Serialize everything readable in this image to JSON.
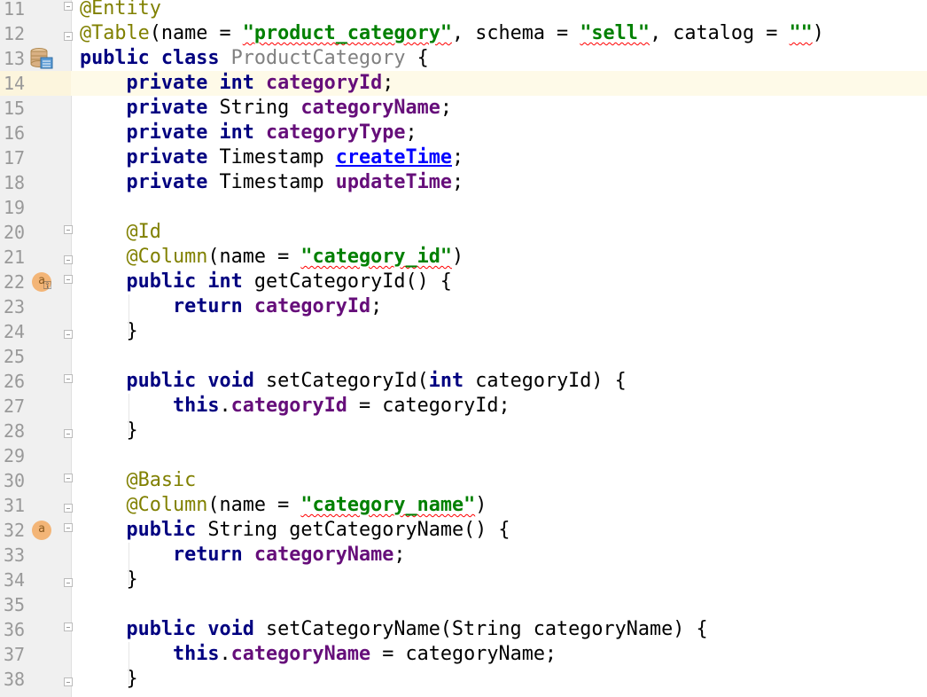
{
  "editor": {
    "current_line": 14,
    "lines": [
      {
        "n": "11",
        "fold": "open",
        "tokens": [
          [
            "@Entity",
            "ann"
          ]
        ]
      },
      {
        "n": "12",
        "fold": "close",
        "tokens": [
          [
            "@Table",
            "ann"
          ],
          [
            "(name = ",
            ""
          ],
          [
            "\"product_category\"",
            "str squig"
          ],
          [
            ", schema = ",
            ""
          ],
          [
            "\"sell\"",
            "str squig"
          ],
          [
            ", catalog = ",
            ""
          ],
          [
            "\"\"",
            "str squig"
          ],
          [
            ")",
            ""
          ]
        ]
      },
      {
        "n": "13",
        "icon": "database-table-icon",
        "tokens": [
          [
            "public class ",
            "kw"
          ],
          [
            "ProductCategory",
            "unused"
          ],
          [
            " {",
            ""
          ]
        ]
      },
      {
        "n": "14",
        "tokens": [
          [
            "    private int ",
            "kw"
          ],
          [
            "categoryId",
            "fld"
          ],
          [
            ";",
            ""
          ]
        ]
      },
      {
        "n": "15",
        "tokens": [
          [
            "    private ",
            "kw"
          ],
          [
            "String ",
            ""
          ],
          [
            "categoryName",
            "fld"
          ],
          [
            ";",
            ""
          ]
        ]
      },
      {
        "n": "16",
        "tokens": [
          [
            "    private int ",
            "kw"
          ],
          [
            "categoryType",
            "fld"
          ],
          [
            ";",
            ""
          ]
        ]
      },
      {
        "n": "17",
        "tokens": [
          [
            "    private ",
            "kw"
          ],
          [
            "Timestamp ",
            ""
          ],
          [
            "createTime",
            "link"
          ],
          [
            ";",
            ""
          ]
        ]
      },
      {
        "n": "18",
        "tokens": [
          [
            "    private ",
            "kw"
          ],
          [
            "Timestamp ",
            ""
          ],
          [
            "updateTime",
            "fld"
          ],
          [
            ";",
            ""
          ]
        ]
      },
      {
        "n": "19",
        "tokens": []
      },
      {
        "n": "20",
        "fold": "open",
        "tokens": [
          [
            "    @Id",
            "ann"
          ]
        ]
      },
      {
        "n": "21",
        "fold": "close",
        "tokens": [
          [
            "    @Column",
            "ann"
          ],
          [
            "(name = ",
            ""
          ],
          [
            "\"category_id\"",
            "str squig"
          ],
          [
            ")",
            ""
          ]
        ]
      },
      {
        "n": "22",
        "fold": "open",
        "icon": "attribute-key-icon",
        "icon_text": "a",
        "tokens": [
          [
            "    public int ",
            "kw"
          ],
          [
            "getCategoryId() {",
            ""
          ]
        ]
      },
      {
        "n": "23",
        "tokens": [
          [
            "        return ",
            "kw"
          ],
          [
            "categoryId",
            "fld"
          ],
          [
            ";",
            ""
          ]
        ]
      },
      {
        "n": "24",
        "fold": "close",
        "tokens": [
          [
            "    }",
            ""
          ]
        ]
      },
      {
        "n": "25",
        "tokens": []
      },
      {
        "n": "26",
        "fold": "open",
        "tokens": [
          [
            "    public void ",
            "kw"
          ],
          [
            "setCategoryId(",
            ""
          ],
          [
            "int ",
            "kw"
          ],
          [
            "categoryId) {",
            ""
          ]
        ]
      },
      {
        "n": "27",
        "tokens": [
          [
            "        this",
            "kw"
          ],
          [
            ".",
            ""
          ],
          [
            "categoryId",
            "fld"
          ],
          [
            " = categoryId;",
            ""
          ]
        ]
      },
      {
        "n": "28",
        "fold": "close",
        "tokens": [
          [
            "    }",
            ""
          ]
        ]
      },
      {
        "n": "29",
        "tokens": []
      },
      {
        "n": "30",
        "fold": "open",
        "tokens": [
          [
            "    @Basic",
            "ann"
          ]
        ]
      },
      {
        "n": "31",
        "fold": "close",
        "tokens": [
          [
            "    @Column",
            "ann"
          ],
          [
            "(name = ",
            ""
          ],
          [
            "\"category_name\"",
            "str squig"
          ],
          [
            ")",
            ""
          ]
        ]
      },
      {
        "n": "32",
        "fold": "open",
        "icon": "attribute-icon",
        "icon_text": "a",
        "tokens": [
          [
            "    public ",
            "kw"
          ],
          [
            "String getCategoryName() {",
            ""
          ]
        ]
      },
      {
        "n": "33",
        "tokens": [
          [
            "        return ",
            "kw"
          ],
          [
            "categoryName",
            "fld"
          ],
          [
            ";",
            ""
          ]
        ]
      },
      {
        "n": "34",
        "fold": "close",
        "tokens": [
          [
            "    }",
            ""
          ]
        ]
      },
      {
        "n": "35",
        "tokens": []
      },
      {
        "n": "36",
        "fold": "open",
        "tokens": [
          [
            "    public void ",
            "kw"
          ],
          [
            "setCategoryName(String categoryName) {",
            ""
          ]
        ]
      },
      {
        "n": "37",
        "tokens": [
          [
            "        this",
            "kw"
          ],
          [
            ".",
            ""
          ],
          [
            "categoryName",
            "fld"
          ],
          [
            " = categoryName;",
            ""
          ]
        ]
      },
      {
        "n": "38",
        "fold": "close",
        "tokens": [
          [
            "    }",
            ""
          ]
        ]
      }
    ]
  }
}
